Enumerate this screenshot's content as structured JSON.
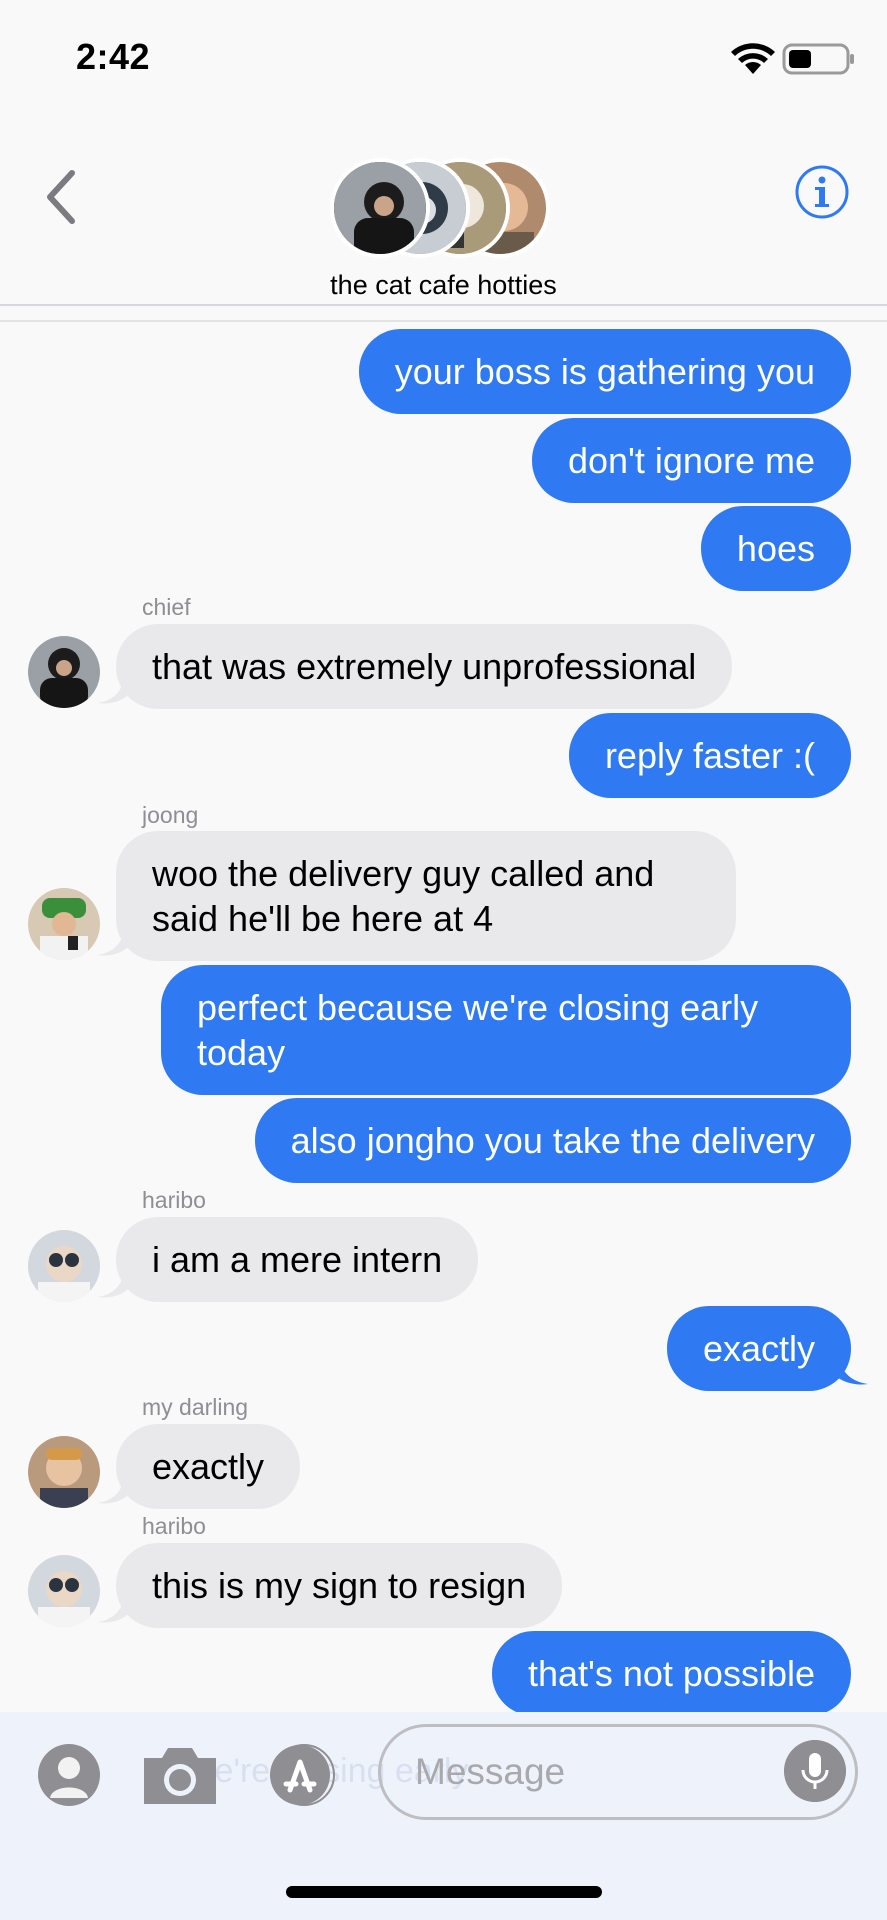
{
  "status": {
    "time": "2:42"
  },
  "header": {
    "group_name": "the cat cafe hotties"
  },
  "messages": [
    {
      "text": "your boss is gathering you"
    },
    {
      "text": "don't ignore me"
    },
    {
      "text": "hoes"
    },
    {
      "sender": "chief",
      "text": "that was extremely unprofessional"
    },
    {
      "text": "reply faster :("
    },
    {
      "sender": "joong",
      "text": "woo the delivery guy called and said he'll be here at 4"
    },
    {
      "text": "perfect because we're closing early today"
    },
    {
      "text": "also jongho you take the delivery"
    },
    {
      "sender": "haribo",
      "text": "i am a mere intern"
    },
    {
      "text": "exactly"
    },
    {
      "sender": "my darling",
      "text": "exactly"
    },
    {
      "sender": "haribo",
      "text": "this is my sign to resign"
    },
    {
      "text": "that's not possible"
    }
  ],
  "composer": {
    "placeholder": "Message",
    "ghost_text": "we're closing early"
  },
  "colors": {
    "outgoing_bubble": "#2f7af2",
    "incoming_bubble": "#e9e9ec",
    "accent": "#2f7af2"
  },
  "icons": [
    "wifi-icon",
    "battery-icon",
    "back-chevron-icon",
    "info-icon",
    "contact-icon",
    "camera-icon",
    "app-store-icon",
    "microphone-icon"
  ]
}
